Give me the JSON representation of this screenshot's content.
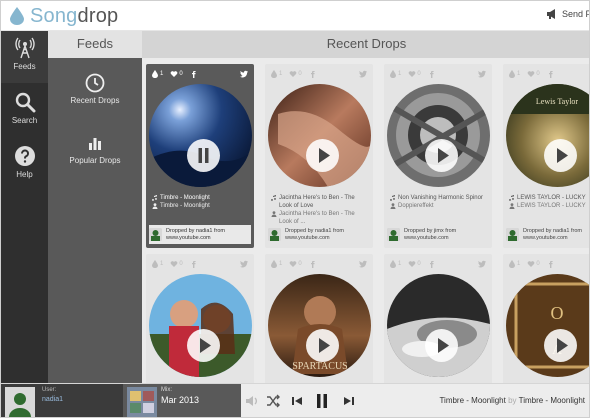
{
  "app": {
    "logo_song": "Song",
    "logo_drop": "drop",
    "send_label": "Send F"
  },
  "rail": {
    "items": [
      {
        "label": "Feeds",
        "icon": "broadcast-tower-icon"
      },
      {
        "label": "Search",
        "icon": "search-icon"
      },
      {
        "label": "Help",
        "icon": "help-icon"
      }
    ]
  },
  "feeds_panel": {
    "title": "Feeds",
    "items": [
      {
        "label": "Recent Drops",
        "icon": "clock-icon"
      },
      {
        "label": "Popular Drops",
        "icon": "bar-chart-icon"
      }
    ]
  },
  "main": {
    "title": "Recent Drops"
  },
  "cards": [
    {
      "likes": "1",
      "hearts": "0",
      "title": "Timbre - Moonlight",
      "artist": "Timbre - Moonlight",
      "dropped_by": "Dropped by nadia1 from",
      "source": "www.youtube.com",
      "state": "pause"
    },
    {
      "likes": "1",
      "hearts": "0",
      "title": "Jacintha Here's to Ben - The Look of Love",
      "artist": "Jacintha Here's to Ben - The Look of ...",
      "dropped_by": "Dropped by nadia1 from",
      "source": "www.youtube.com",
      "state": "play"
    },
    {
      "likes": "1",
      "hearts": "0",
      "title": "Non Vanishing Harmonic Spinor",
      "artist": "Doppiereffekt",
      "dropped_by": "Dropped by jimx from",
      "source": "www.youtube.com",
      "state": "play"
    },
    {
      "likes": "1",
      "hearts": "0",
      "title": "LEWIS TAYLOR - LUCKY",
      "artist": "LEWIS TAYLOR - LUCKY",
      "dropped_by": "Dropped by nadia1 from",
      "source": "www.youtube.com",
      "state": "play"
    },
    {
      "likes": "1",
      "hearts": "0",
      "title": "",
      "artist": "",
      "dropped_by": "",
      "source": "",
      "state": "play"
    },
    {
      "likes": "1",
      "hearts": "0",
      "title": "",
      "artist": "",
      "dropped_by": "",
      "source": "",
      "state": "play"
    },
    {
      "likes": "1",
      "hearts": "0",
      "title": "",
      "artist": "",
      "dropped_by": "",
      "source": "",
      "state": "play"
    },
    {
      "likes": "1",
      "hearts": "0",
      "title": "",
      "artist": "",
      "dropped_by": "",
      "source": "",
      "state": "play"
    }
  ],
  "player": {
    "user_label": "User:",
    "user_name": "nadia1",
    "mix_label": "Mix:",
    "mix_name": "Mar 2013",
    "now_track": "Timbre - Moonlight",
    "now_by": "by",
    "now_artist": "Timbre - Moonlight"
  },
  "colors": {
    "accent": "#7ab0c9",
    "rail": "#2f2f2f",
    "panel": "#595959"
  }
}
